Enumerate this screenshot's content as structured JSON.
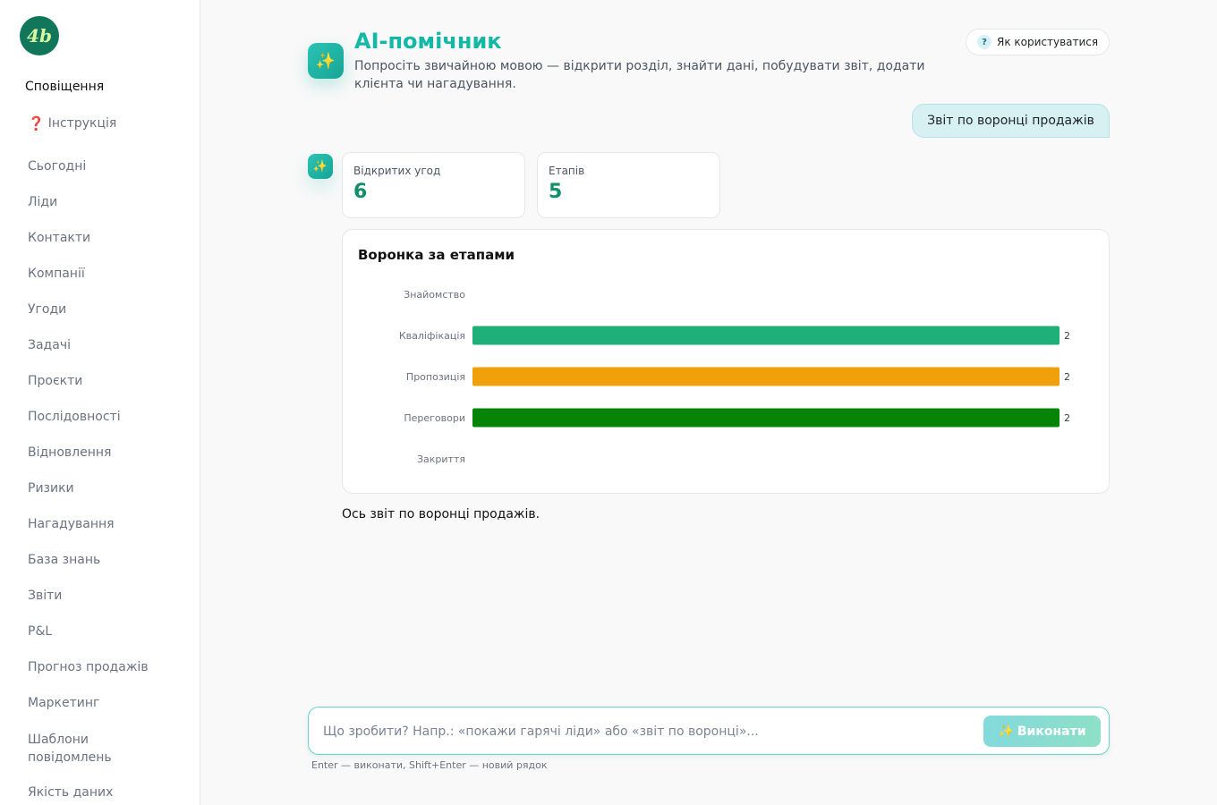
{
  "sidebar": {
    "logo_text": "4b",
    "notifications": "Сповіщення",
    "instructions_icon": "❓",
    "instructions": "Інструкція",
    "items": [
      {
        "label": "Сьогодні"
      },
      {
        "label": "Ліди"
      },
      {
        "label": "Контакти"
      },
      {
        "label": "Компанії"
      },
      {
        "label": "Угоди"
      },
      {
        "label": "Задачі"
      },
      {
        "label": "Проєкти"
      },
      {
        "label": "Послідовності"
      },
      {
        "label": "Відновлення"
      },
      {
        "label": "Ризики"
      },
      {
        "label": "Нагадування"
      },
      {
        "label": "База знань"
      },
      {
        "label": "Звіти"
      },
      {
        "label": "P&L"
      },
      {
        "label": "Прогноз продажів"
      },
      {
        "label": "Маркетинг"
      },
      {
        "label": "Шаблони повідомлень"
      },
      {
        "label": "Якість даних"
      }
    ]
  },
  "header": {
    "icon": "sparkles-icon",
    "title": "AI-помічник",
    "subtitle": "Попросіть звичайною мовою — відкрити розділ, знайти дані, побудувати звіт, додати клієнта чи нагадування.",
    "howto_icon": "?",
    "howto_label": "Як користуватися"
  },
  "conversation": {
    "user_message": "Звіт по воронці продажів",
    "stats": [
      {
        "label": "Відкритих угод",
        "value": "6"
      },
      {
        "label": "Етапів",
        "value": "5"
      }
    ],
    "reply": "Ось звіт по воронці продажів."
  },
  "chart_data": {
    "type": "bar",
    "orientation": "horizontal",
    "title": "Воронка за етапами",
    "categories": [
      "Знайомство",
      "Кваліфікація",
      "Пропозиція",
      "Переговори",
      "Закриття"
    ],
    "values": [
      0,
      2,
      2,
      2,
      0
    ],
    "value_labels": [
      "",
      "2",
      "2",
      "2",
      ""
    ],
    "colors": [
      "#1fb07a",
      "#1fb07a",
      "#f0a00a",
      "#078407",
      "#1fb07a"
    ],
    "xlim": [
      0,
      2
    ],
    "grid": false,
    "legend": "none"
  },
  "composer": {
    "placeholder": "Що зробити? Напр.: «покажи гарячі ліди» або «звіт по воронці»...",
    "button_label": "Виконати",
    "hint": "Enter — виконати, Shift+Enter — новий рядок"
  }
}
